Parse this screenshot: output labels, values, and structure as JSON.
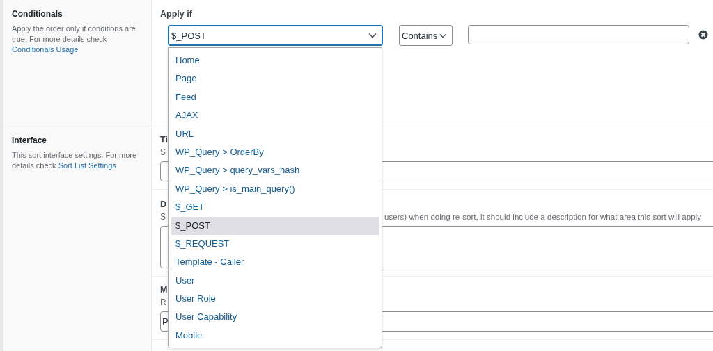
{
  "conditionals": {
    "title": "Conditionals",
    "description": "Apply the order only if conditions are true. For more details check",
    "link": "Conditionals Usage",
    "label": "Apply if",
    "source_select": {
      "value": "$_POST",
      "expanded": true
    },
    "operator_select": {
      "value": "Contains"
    }
  },
  "interface": {
    "title": "Interface",
    "description": "This sort interface settings. For more details check",
    "link": "Sort List Settings",
    "fields": [
      {
        "kind": "input",
        "label": "Ti",
        "hint": "S"
      },
      {
        "kind": "textarea",
        "label": "D",
        "hint": "S",
        "hint_tail": "users) when doing re-sort, it should include a description for what area this sort will apply"
      },
      {
        "kind": "input",
        "label": "M",
        "hint": "R",
        "value": "P"
      }
    ]
  },
  "dropdown_options": [
    {
      "label": "Home",
      "selected": false
    },
    {
      "label": "Page",
      "selected": false
    },
    {
      "label": "Feed",
      "selected": false
    },
    {
      "label": "AJAX",
      "selected": false
    },
    {
      "label": "URL",
      "selected": false
    },
    {
      "label": "WP_Query > OrderBy",
      "selected": false
    },
    {
      "label": "WP_Query > query_vars_hash",
      "selected": false
    },
    {
      "label": "WP_Query > is_main_query()",
      "selected": false
    },
    {
      "label": "$_GET",
      "selected": false
    },
    {
      "label": "$_POST",
      "selected": true
    },
    {
      "label": "$_REQUEST",
      "selected": false
    },
    {
      "label": "Template - Caller",
      "selected": false
    },
    {
      "label": "User",
      "selected": false
    },
    {
      "label": "User Role",
      "selected": false
    },
    {
      "label": "User Capability",
      "selected": false
    },
    {
      "label": "Mobile",
      "selected": false
    }
  ]
}
